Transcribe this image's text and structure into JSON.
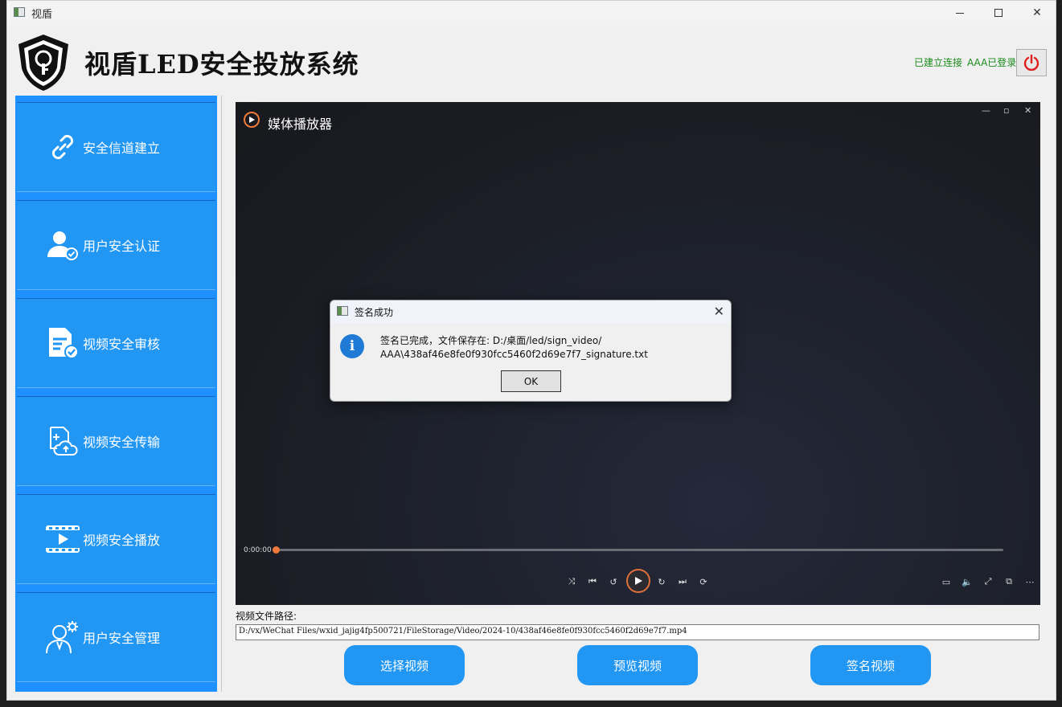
{
  "window": {
    "title": "视盾"
  },
  "header": {
    "app_title": "视盾LED安全投放系统",
    "status_connected": "已建立连接",
    "status_user": "AAA已登录"
  },
  "sidebar": {
    "items": [
      {
        "label": "安全信道建立",
        "icon": "link-icon"
      },
      {
        "label": "用户安全认证",
        "icon": "user-check-icon"
      },
      {
        "label": "视频安全审核",
        "icon": "document-check-icon"
      },
      {
        "label": "视频安全传输",
        "icon": "file-upload-icon"
      },
      {
        "label": "视频安全播放",
        "icon": "film-play-icon"
      },
      {
        "label": "用户安全管理",
        "icon": "user-gear-icon"
      }
    ]
  },
  "player": {
    "title": "媒体播放器",
    "time": "0:00:00",
    "progress": 0
  },
  "main": {
    "path_label": "视频文件路径:",
    "path_value": "D:/vx/WeChat Files/wxid_jajig4fp500721/FileStorage/Video/2024-10/438af46e8fe0f930fcc5460f2d69e7f7.mp4",
    "buttons": {
      "select": "选择视频",
      "preview": "预览视频",
      "sign": "签名视频"
    }
  },
  "dialog": {
    "title": "签名成功",
    "message_line1": "签名已完成，文件保存在: D:/桌面/led/sign_video/",
    "message_line2": "AAA\\438af46e8fe0f930fcc5460f2d69e7f7_signature.txt",
    "ok": "OK"
  },
  "colors": {
    "sidebar_blue": "#2196f3",
    "status_green": "#1a8a1a",
    "power_red": "#e02020",
    "player_accent": "#f07a3a"
  }
}
